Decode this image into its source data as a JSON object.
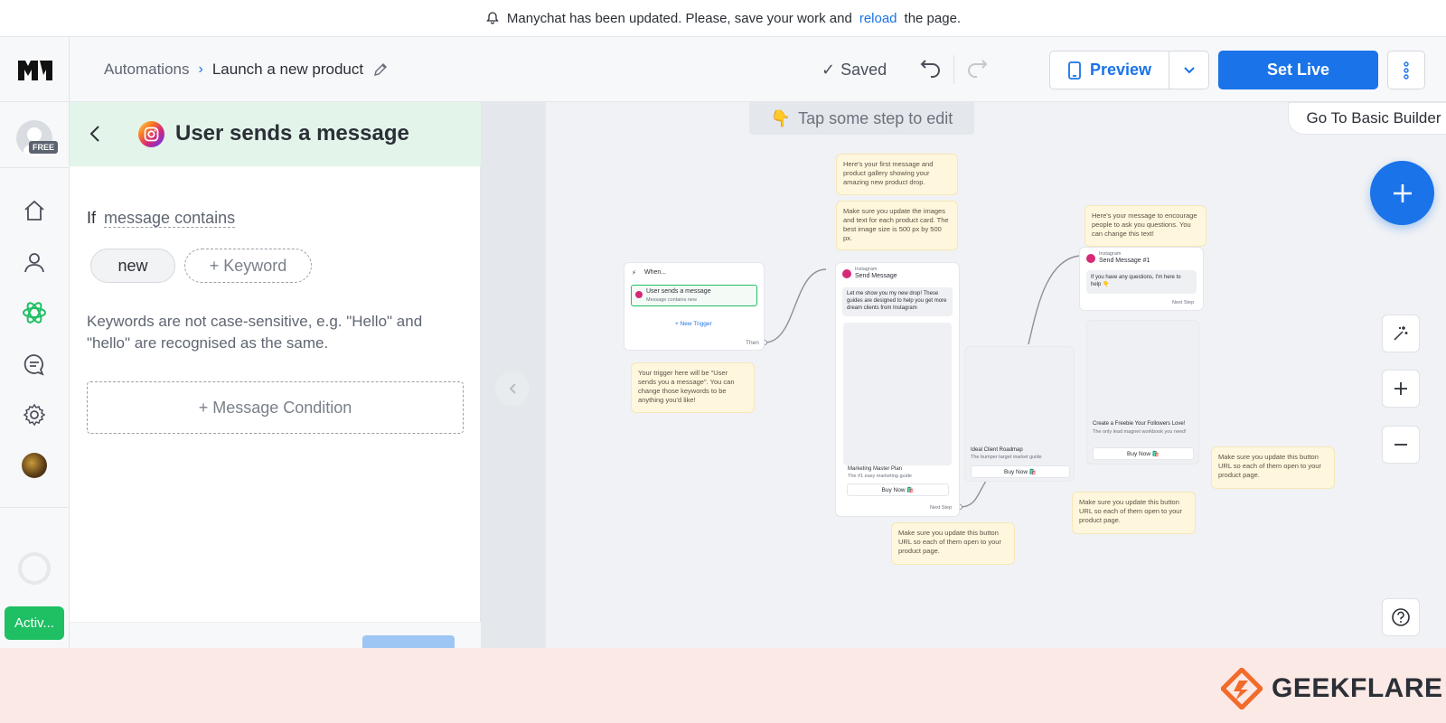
{
  "banner": {
    "text_before": "Manychat has been updated. Please, save your work and",
    "link": "reload",
    "text_after": "the page."
  },
  "nav": {
    "plan_badge": "FREE",
    "status": "Activ..."
  },
  "header": {
    "breadcrumb_root": "Automations",
    "breadcrumb_current": "Launch a new product",
    "saved": "Saved",
    "preview": "Preview",
    "set_live": "Set Live"
  },
  "panel": {
    "title": "User sends a message",
    "condition_prefix": "If",
    "condition_link": "message contains",
    "keyword": "new",
    "add_keyword": "+ Keyword",
    "hint": "Keywords are not case-sensitive, e.g. \"Hello\" and \"hello\" are recognised as the same.",
    "message_condition": "+ Message Condition"
  },
  "canvas": {
    "tap_hint": "Tap some step to edit",
    "basic_builder": "Go To Basic Builder",
    "notes": {
      "n1": "Here's your first message and product gallery showing your amazing new product drop.",
      "n2": "Make sure you update the images and text for each product card. The best image size is 500 px by 500 px.",
      "n3": "Here's your message to encourage people to ask you questions. You can change this text!",
      "n4": "Your trigger here will be \"User sends you a message\". You can change those keywords to be anything you'd like!",
      "n5": "Make sure you update this button URL so each of them open to your product page.",
      "n6": "Make sure you update this button URL so each of them open to your product page.",
      "n7": "Make sure you update this button URL so each of them open to your product page."
    },
    "trigger": {
      "when": "When...",
      "item": "User sends a message",
      "item_sub": "Message contains new",
      "new_trigger": "+ New Trigger",
      "then": "Then"
    },
    "msg1": {
      "channel": "Instagram",
      "title": "Send Message",
      "text": "Let me show you my new drop! These guides are designed to help you get more dream clients from Instagram",
      "card1_title": "Marketing Master Plan",
      "card1_sub": "The #1 easy marketing guide",
      "card2_title": "Ideal Client Roadmap",
      "card2_sub": "The bumper target market guide",
      "buy": "Buy Now 🛍️",
      "next": "Next Step"
    },
    "msg2": {
      "channel": "Instagram",
      "title": "Send Message #1",
      "text": "If you have any questions, I'm here to help 👇",
      "next": "Next Step",
      "card_title": "Create a Freebie Your Followers Love!",
      "card_sub": "The only lead magnet workbook you need!",
      "buy": "Buy Now 🛍️"
    }
  },
  "brand": {
    "name": "GEEKFLARE"
  }
}
